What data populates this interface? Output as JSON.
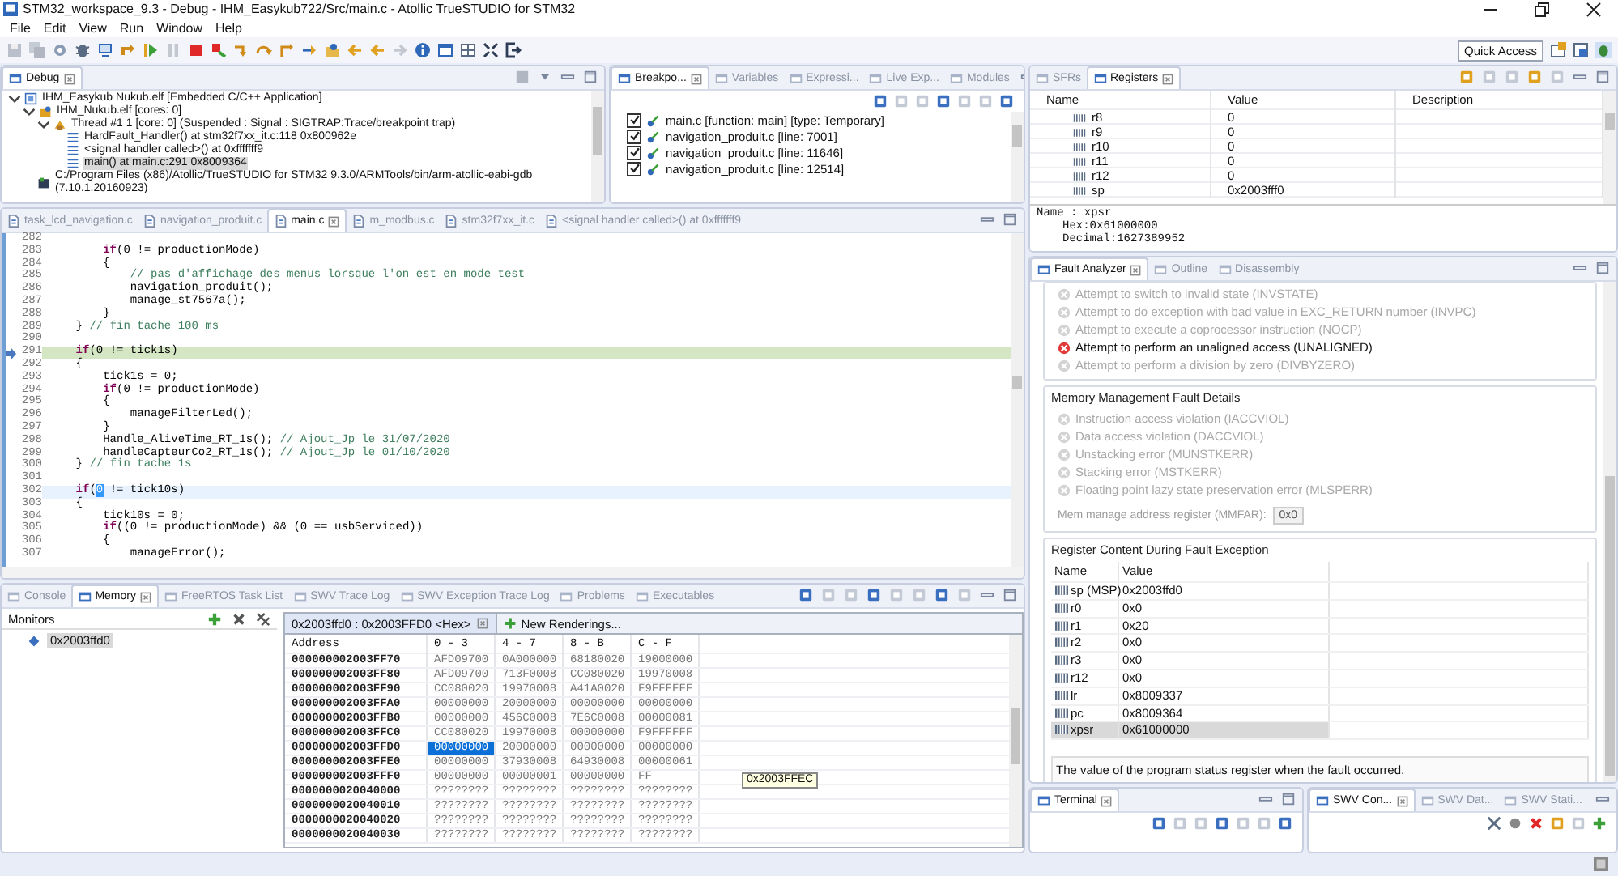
{
  "window": {
    "title": "STM32_workspace_9.3 - Debug - IHM_Easykub722/Src/main.c - Atollic TrueSTUDIO for STM32"
  },
  "menu": [
    "File",
    "Edit",
    "View",
    "Run",
    "Window",
    "Help"
  ],
  "quick_access": "Quick Access",
  "debug_panel": {
    "tabs": [
      {
        "label": "Debug",
        "selected": true
      }
    ],
    "tree": [
      {
        "kind": "launch",
        "label": "IHM_Easykub Nukub.elf [Embedded C/C++ Application]",
        "selected": false,
        "expanded": true,
        "children": [
          {
            "kind": "process",
            "label": "IHM_Nukub.elf [cores: 0]",
            "selected": false,
            "expanded": true,
            "children": [
              {
                "kind": "thread",
                "label": "Thread #1 1 [core: 0] (Suspended : Signal : SIGTRAP:Trace/breakpoint trap)",
                "selected": false,
                "expanded": true,
                "children": [
                  {
                    "kind": "frame",
                    "label": "HardFault_Handler() at stm32f7xx_it.c:118 0x800962e",
                    "selected": false
                  },
                  {
                    "kind": "frame",
                    "label": "<signal handler called>() at 0xfffffff9",
                    "selected": false
                  },
                  {
                    "kind": "frame",
                    "label": "main() at main.c:291 0x8009364",
                    "selected": true
                  }
                ]
              }
            ]
          },
          {
            "kind": "gdb",
            "label": "C:/Program Files (x86)/Atollic/TrueSTUDIO for STM32 9.3.0/ARMTools/bin/arm-atollic-eabi-gdb (7.10.1.20160923)",
            "selected": false
          }
        ]
      }
    ]
  },
  "breakpoints_panel": {
    "tabs": [
      {
        "label": "Breakpo...",
        "selected": true
      },
      {
        "label": "Variables",
        "selected": false
      },
      {
        "label": "Expressi...",
        "selected": false
      },
      {
        "label": "Live Exp...",
        "selected": false
      },
      {
        "label": "Modules",
        "selected": false
      }
    ],
    "items": [
      {
        "label": "main.c [function: main] [type: Temporary]",
        "checked": true
      },
      {
        "label": "navigation_produit.c [line: 7001]",
        "checked": true
      },
      {
        "label": "navigation_produit.c [line: 11646]",
        "checked": true
      },
      {
        "label": "navigation_produit.c [line: 12514]",
        "checked": true
      }
    ]
  },
  "editor": {
    "tabs": [
      {
        "label": "task_lcd_navigation.c",
        "selected": false
      },
      {
        "label": "navigation_produit.c",
        "selected": false
      },
      {
        "label": "main.c",
        "selected": true
      },
      {
        "label": "m_modbus.c",
        "selected": false
      },
      {
        "label": "stm32f7xx_it.c",
        "selected": false
      },
      {
        "label": "<signal handler called>() at 0xfffffff9",
        "selected": false
      }
    ],
    "lines": [
      {
        "number": "282",
        "executing": false,
        "cursor": false
      },
      {
        "number": "283",
        "tokens": [
          {
            "kind": "keyword",
            "text": "        if"
          },
          {
            "kind": "plain",
            "text": "(0 != productionMode)"
          }
        ],
        "executing": false,
        "cursor": false
      },
      {
        "number": "284",
        "tokens": [
          {
            "kind": "plain",
            "text": "        {"
          }
        ],
        "executing": false,
        "cursor": false
      },
      {
        "number": "285",
        "tokens": [
          {
            "kind": "comment",
            "text": "            // pas d'affichage des menus lorsque l'on est en mode test"
          }
        ],
        "executing": false,
        "cursor": false
      },
      {
        "number": "286",
        "tokens": [
          {
            "kind": "plain",
            "text": "            navigation_produit();"
          }
        ],
        "executing": false,
        "cursor": false
      },
      {
        "number": "287",
        "tokens": [
          {
            "kind": "plain",
            "text": "            manage_st7567a();"
          }
        ],
        "executing": false,
        "cursor": false
      },
      {
        "number": "288",
        "tokens": [
          {
            "kind": "plain",
            "text": "        }"
          }
        ],
        "executing": false,
        "cursor": false
      },
      {
        "number": "289",
        "tokens": [
          {
            "kind": "plain",
            "text": "    } "
          },
          {
            "kind": "comment",
            "text": "// fin tache 100 ms"
          }
        ],
        "executing": false,
        "cursor": false
      },
      {
        "number": "290",
        "executing": false,
        "cursor": false
      },
      {
        "number": "291",
        "tokens": [
          {
            "kind": "keyword",
            "text": "    if"
          },
          {
            "kind": "plain",
            "text": "(0 != tick1s)"
          }
        ],
        "executing": true,
        "cursor": false
      },
      {
        "number": "292",
        "tokens": [
          {
            "kind": "plain",
            "text": "    {"
          }
        ],
        "executing": false,
        "cursor": false
      },
      {
        "number": "293",
        "tokens": [
          {
            "kind": "plain",
            "text": "        tick1s = 0;"
          }
        ],
        "executing": false,
        "cursor": false
      },
      {
        "number": "294",
        "tokens": [
          {
            "kind": "keyword",
            "text": "        if"
          },
          {
            "kind": "plain",
            "text": "(0 != productionMode)"
          }
        ],
        "executing": false,
        "cursor": false
      },
      {
        "number": "295",
        "tokens": [
          {
            "kind": "plain",
            "text": "        {"
          }
        ],
        "executing": false,
        "cursor": false
      },
      {
        "number": "296",
        "tokens": [
          {
            "kind": "plain",
            "text": "            manageFilterLed();"
          }
        ],
        "executing": false,
        "cursor": false
      },
      {
        "number": "297",
        "tokens": [
          {
            "kind": "plain",
            "text": "        }"
          }
        ],
        "executing": false,
        "cursor": false
      },
      {
        "number": "298",
        "tokens": [
          {
            "kind": "plain",
            "text": "        Handle_AliveTime_RT_1s(); "
          },
          {
            "kind": "comment",
            "text": "// Ajout_Jp le 31/07/2020"
          }
        ],
        "executing": false,
        "cursor": false
      },
      {
        "number": "299",
        "tokens": [
          {
            "kind": "plain",
            "text": "        handleCapteurCo2_RT_1s(); "
          },
          {
            "kind": "comment",
            "text": "// Ajout_Jp le 01/10/2020"
          }
        ],
        "executing": false,
        "cursor": false
      },
      {
        "number": "300",
        "tokens": [
          {
            "kind": "plain",
            "text": "    } "
          },
          {
            "kind": "comment",
            "text": "// fin tache 1s"
          }
        ],
        "executing": false,
        "cursor": false
      },
      {
        "number": "301",
        "executing": false,
        "cursor": false
      },
      {
        "number": "302",
        "tokens": [
          {
            "kind": "keyword",
            "text": "    if"
          },
          {
            "kind": "plain",
            "text": "("
          },
          {
            "kind": "selection",
            "text": "0"
          },
          {
            "kind": "plain",
            "text": " != tick10s)"
          }
        ],
        "executing": false,
        "cursor": true
      },
      {
        "number": "303",
        "tokens": [
          {
            "kind": "plain",
            "text": "    {"
          }
        ],
        "executing": false,
        "cursor": false
      },
      {
        "number": "304",
        "tokens": [
          {
            "kind": "plain",
            "text": "        tick10s = 0;"
          }
        ],
        "executing": false,
        "cursor": false
      },
      {
        "number": "305",
        "tokens": [
          {
            "kind": "keyword",
            "text": "        if"
          },
          {
            "kind": "plain",
            "text": "((0 != productionMode) && (0 == usbServiced))"
          }
        ],
        "executing": false,
        "cursor": false
      },
      {
        "number": "306",
        "tokens": [
          {
            "kind": "plain",
            "text": "        {"
          }
        ],
        "executing": false,
        "cursor": false
      },
      {
        "number": "307",
        "tokens": [
          {
            "kind": "plain",
            "text": "            manageError();"
          }
        ],
        "executing": false,
        "cursor": false
      }
    ]
  },
  "memory_panel": {
    "tabs": [
      {
        "label": "Console",
        "selected": false
      },
      {
        "label": "Memory",
        "selected": true
      },
      {
        "label": "FreeRTOS Task List",
        "selected": false
      },
      {
        "label": "SWV Trace Log",
        "selected": false
      },
      {
        "label": "SWV Exception Trace Log",
        "selected": false
      },
      {
        "label": "Problems",
        "selected": false
      },
      {
        "label": "Executables",
        "selected": false
      }
    ],
    "monitors_title": "Monitors",
    "monitors": [
      {
        "label": "0x2003ffd0",
        "selected": true
      }
    ],
    "rendering_tabs": [
      {
        "label": "0x2003ffd0 : 0x2003FFD0 <Hex>",
        "selected": true
      },
      {
        "label": "New Renderings...",
        "selected": false
      }
    ],
    "columns": [
      "Address",
      "0 - 3",
      "4 - 7",
      "8 - B",
      "C - F"
    ],
    "rows": [
      {
        "cells": [
          {
            "text": "000000002003FF70",
            "selected": false
          },
          {
            "text": "AFD09700",
            "selected": false
          },
          {
            "text": "0A000000",
            "selected": false
          },
          {
            "text": "68180020",
            "selected": false
          },
          {
            "text": "19000000",
            "selected": false
          }
        ]
      },
      {
        "cells": [
          {
            "text": "000000002003FF80",
            "selected": false
          },
          {
            "text": "AFD09700",
            "selected": false
          },
          {
            "text": "713F0008",
            "selected": false
          },
          {
            "text": "CC080020",
            "selected": false
          },
          {
            "text": "19970008",
            "selected": false
          }
        ]
      },
      {
        "cells": [
          {
            "text": "000000002003FF90",
            "selected": false
          },
          {
            "text": "CC080020",
            "selected": false
          },
          {
            "text": "19970008",
            "selected": false
          },
          {
            "text": "A41A0020",
            "selected": false
          },
          {
            "text": "F9FFFFFF",
            "selected": false
          }
        ]
      },
      {
        "cells": [
          {
            "text": "000000002003FFA0",
            "selected": false
          },
          {
            "text": "00000000",
            "selected": false
          },
          {
            "text": "20000000",
            "selected": false
          },
          {
            "text": "00000000",
            "selected": false
          },
          {
            "text": "00000000",
            "selected": false
          }
        ]
      },
      {
        "cells": [
          {
            "text": "000000002003FFB0",
            "selected": false
          },
          {
            "text": "00000000",
            "selected": false
          },
          {
            "text": "456C0008",
            "selected": false
          },
          {
            "text": "7E6C0008",
            "selected": false
          },
          {
            "text": "00000081",
            "selected": false
          }
        ]
      },
      {
        "cells": [
          {
            "text": "000000002003FFC0",
            "selected": false
          },
          {
            "text": "CC080020",
            "selected": false
          },
          {
            "text": "19970008",
            "selected": false
          },
          {
            "text": "00000000",
            "selected": false
          },
          {
            "text": "F9FFFFFF",
            "selected": false
          }
        ]
      },
      {
        "cells": [
          {
            "text": "000000002003FFD0",
            "selected": false
          },
          {
            "text": "00000000",
            "selected": true
          },
          {
            "text": "20000000",
            "selected": false
          },
          {
            "text": "00000000",
            "selected": false
          },
          {
            "text": "00000000",
            "selected": false
          }
        ]
      },
      {
        "cells": [
          {
            "text": "000000002003FFE0",
            "selected": false
          },
          {
            "text": "00000000",
            "selected": false
          },
          {
            "text": "37930008",
            "selected": false
          },
          {
            "text": "64930008",
            "selected": false
          },
          {
            "text": "00000061",
            "selected": false
          }
        ]
      },
      {
        "cells": [
          {
            "text": "000000002003FFF0",
            "selected": false
          },
          {
            "text": "00000000",
            "selected": false
          },
          {
            "text": "00000001",
            "selected": false
          },
          {
            "text": "00000000",
            "selected": false
          },
          {
            "text": "FF",
            "selected": false
          }
        ]
      },
      {
        "cells": [
          {
            "text": "0000000020040000",
            "selected": false
          },
          {
            "text": "????????",
            "selected": false
          },
          {
            "text": "????????",
            "selected": false
          },
          {
            "text": "????????",
            "selected": false
          },
          {
            "text": "????????",
            "selected": false
          }
        ]
      },
      {
        "cells": [
          {
            "text": "0000000020040010",
            "selected": false
          },
          {
            "text": "????????",
            "selected": false
          },
          {
            "text": "????????",
            "selected": false
          },
          {
            "text": "????????",
            "selected": false
          },
          {
            "text": "????????",
            "selected": false
          }
        ]
      },
      {
        "cells": [
          {
            "text": "0000000020040020",
            "selected": false
          },
          {
            "text": "????????",
            "selected": false
          },
          {
            "text": "????????",
            "selected": false
          },
          {
            "text": "????????",
            "selected": false
          },
          {
            "text": "????????",
            "selected": false
          }
        ]
      },
      {
        "cells": [
          {
            "text": "0000000020040030",
            "selected": false
          },
          {
            "text": "????????",
            "selected": false
          },
          {
            "text": "????????",
            "selected": false
          },
          {
            "text": "????????",
            "selected": false
          },
          {
            "text": "????????",
            "selected": false
          }
        ]
      }
    ],
    "tooltip": "0x2003FFEC"
  },
  "registers_panel": {
    "tabs": [
      {
        "label": "SFRs",
        "selected": false
      },
      {
        "label": "Registers",
        "selected": true
      }
    ],
    "columns": [
      "Name",
      "Value",
      "Description"
    ],
    "rows": [
      {
        "name": "r8",
        "value": "0"
      },
      {
        "name": "r9",
        "value": "0"
      },
      {
        "name": "r10",
        "value": "0"
      },
      {
        "name": "r11",
        "value": "0"
      },
      {
        "name": "r12",
        "value": "0"
      },
      {
        "name": "sp",
        "value": "0x2003fff0"
      }
    ],
    "details": [
      "Name : xpsr",
      "Hex:0x61000000",
      "Decimal:1627389952"
    ]
  },
  "fault_analyzer": {
    "tabs": [
      {
        "label": "Fault Analyzer",
        "selected": true
      },
      {
        "label": "Outline",
        "selected": false
      },
      {
        "label": "Disassembly",
        "selected": false
      }
    ],
    "fault_list": [
      {
        "label": "Attempt to switch to invalid state (INVSTATE)",
        "active": false
      },
      {
        "label": "Attempt to do exception with bad value in EXC_RETURN number (INVPC)",
        "active": false
      },
      {
        "label": "Attempt to execute a coprocessor instruction (NOCP)",
        "active": false
      },
      {
        "label": "Attempt to perform an unaligned access (UNALIGNED)",
        "active": true
      },
      {
        "label": "Attempt to perform a division by zero (DIVBYZERO)",
        "active": false
      }
    ],
    "mm_section": {
      "title": "Memory Management Fault Details",
      "items": [
        {
          "label": "Instruction access violation (IACCVIOL)",
          "active": false
        },
        {
          "label": "Data access violation (DACCVIOL)",
          "active": false
        },
        {
          "label": "Unstacking error (MUNSTKERR)",
          "active": false
        },
        {
          "label": "Stacking error (MSTKERR)",
          "active": false
        },
        {
          "label": "Floating point lazy state preservation error (MLSPERR)",
          "active": false
        }
      ],
      "address_label": "Mem manage address register (MMFAR):",
      "address_value": "0x0"
    },
    "register_section": {
      "title": "Register Content During Fault Exception",
      "columns": [
        "Name",
        "Value"
      ],
      "rows": [
        {
          "name": "sp (MSP)",
          "value": "0x2003ffd0",
          "selected": false
        },
        {
          "name": "r0",
          "value": "0x0",
          "selected": false
        },
        {
          "name": "r1",
          "value": "0x20",
          "selected": false
        },
        {
          "name": "r2",
          "value": "0x0",
          "selected": false
        },
        {
          "name": "r3",
          "value": "0x0",
          "selected": false
        },
        {
          "name": "r12",
          "value": "0x0",
          "selected": false
        },
        {
          "name": "lr",
          "value": "0x8009337",
          "selected": false
        },
        {
          "name": "pc",
          "value": "0x8009364",
          "selected": false
        },
        {
          "name": "xpsr",
          "value": "0x61000000",
          "selected": true
        }
      ],
      "description": "The value of the program status register when the fault occurred."
    }
  },
  "terminal_panel": {
    "tabs": [
      {
        "label": "Terminal",
        "selected": true
      }
    ]
  },
  "swv_panel": {
    "tabs": [
      {
        "label": "SWV Con...",
        "selected": true
      },
      {
        "label": "SWV Dat...",
        "selected": false
      },
      {
        "label": "SWV Stati...",
        "selected": false
      }
    ]
  }
}
